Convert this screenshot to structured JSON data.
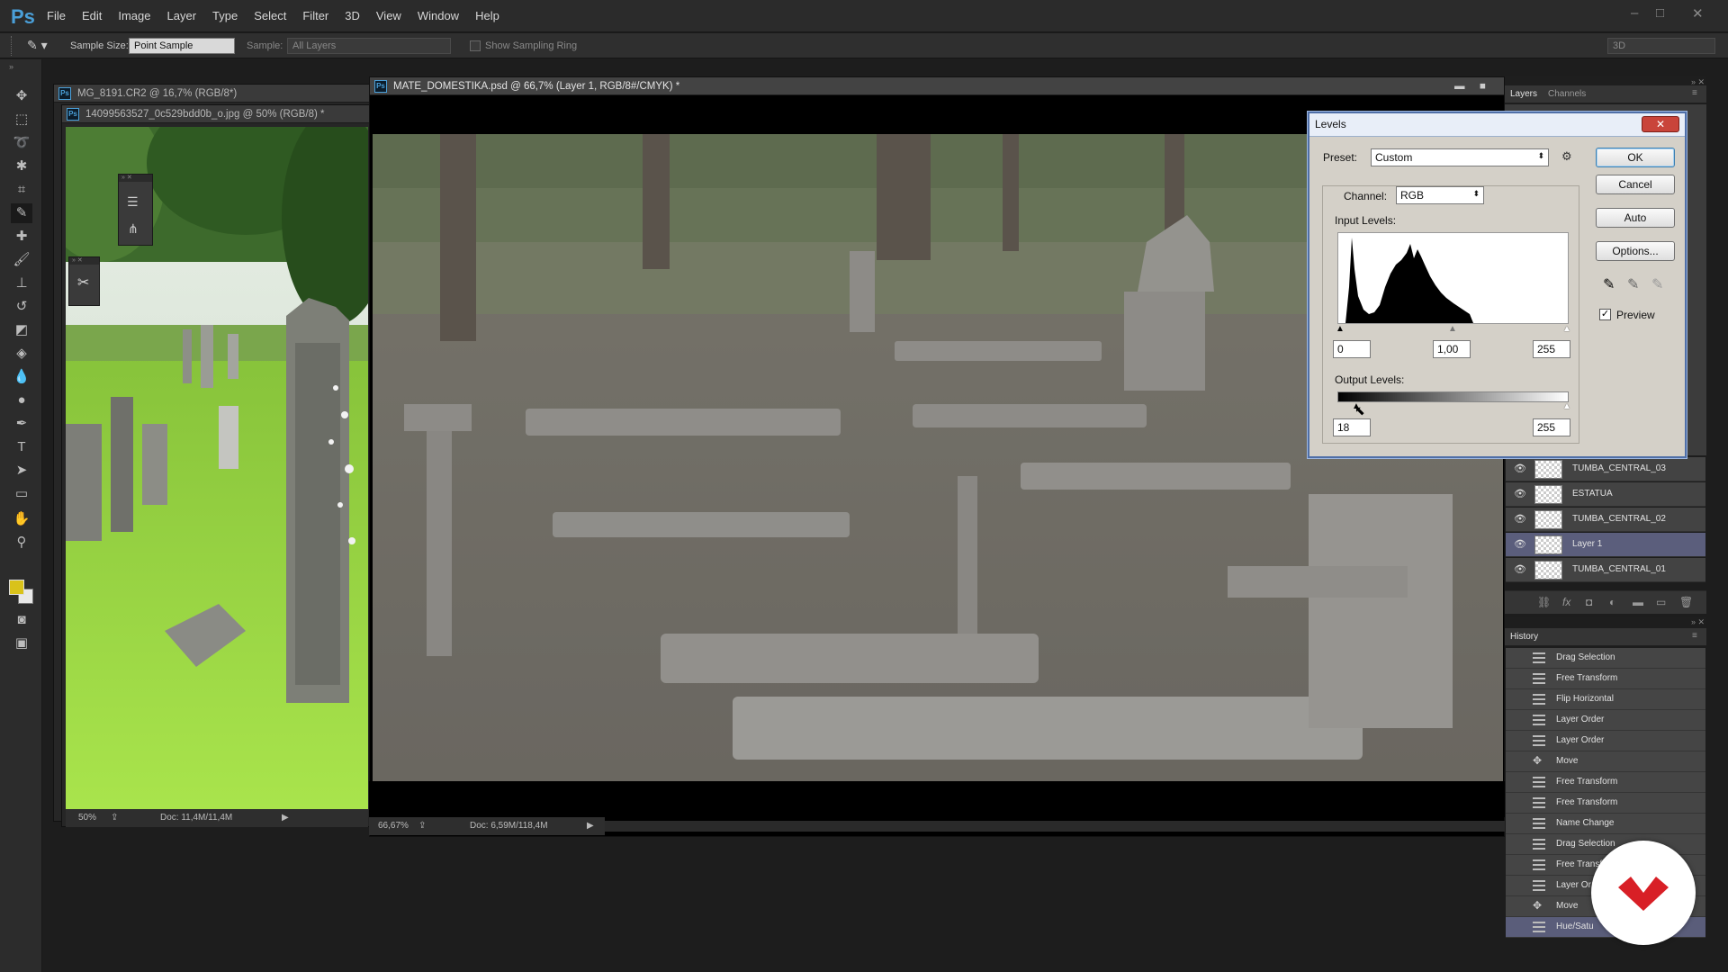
{
  "app": {
    "logo": "Ps",
    "menu": [
      "File",
      "Edit",
      "Image",
      "Layer",
      "Type",
      "Select",
      "Filter",
      "3D",
      "View",
      "Window",
      "Help"
    ]
  },
  "options_bar": {
    "sample_size_label": "Sample Size:",
    "sample_size_value": "Point Sample",
    "sample_label": "Sample:",
    "sample_value": "All Layers",
    "show_ring_label": "Show Sampling Ring",
    "workspace": "3D"
  },
  "documents": {
    "doc1": {
      "title": "MG_8191.CR2 @ 16,7% (RGB/8*)"
    },
    "doc2": {
      "title": "14099563527_0c529bdd0b_o.jpg @ 50% (RGB/8) *",
      "zoom": "50%",
      "doc_info": "Doc: 11,4M/11,4M"
    },
    "main": {
      "title": "MATE_DOMESTIKA.psd @ 66,7% (Layer 1, RGB/8#/CMYK) *",
      "zoom": "66,67%",
      "doc_info": "Doc: 6,59M/118,4M"
    }
  },
  "layers_panel": {
    "tabs": [
      "Layers",
      "Channels"
    ],
    "layers": [
      {
        "name": "TUMBA_CENTRAL_03",
        "selected": false
      },
      {
        "name": "ESTATUA",
        "selected": false
      },
      {
        "name": "TUMBA_CENTRAL_02",
        "selected": false
      },
      {
        "name": "Layer 1",
        "selected": true
      },
      {
        "name": "TUMBA_CENTRAL_01",
        "selected": false
      }
    ]
  },
  "history_panel": {
    "title": "History",
    "items": [
      "Drag Selection",
      "Free Transform",
      "Flip Horizontal",
      "Layer Order",
      "Layer Order",
      "Move",
      "Free Transform",
      "Free Transform",
      "Name Change",
      "Drag Selection",
      "Free Transf",
      "Layer Or",
      "Move",
      "Hue/Satu"
    ]
  },
  "levels_dialog": {
    "title": "Levels",
    "close": "✕",
    "preset_label": "Preset:",
    "preset_value": "Custom",
    "channel_label": "Channel:",
    "channel_value": "RGB",
    "input_levels_label": "Input Levels:",
    "input_black": "0",
    "input_gamma": "1,00",
    "input_white": "255",
    "output_levels_label": "Output Levels:",
    "output_black": "18",
    "output_white": "255",
    "buttons": {
      "ok": "OK",
      "cancel": "Cancel",
      "auto": "Auto",
      "options": "Options..."
    },
    "preview_label": "Preview",
    "preview_checked": true
  },
  "colors": {
    "accent": "#4a9fd8",
    "foreground_swatch": "#d9c21a",
    "selected_layer": "#5b5e7c",
    "logo_red": "#d81f26"
  }
}
